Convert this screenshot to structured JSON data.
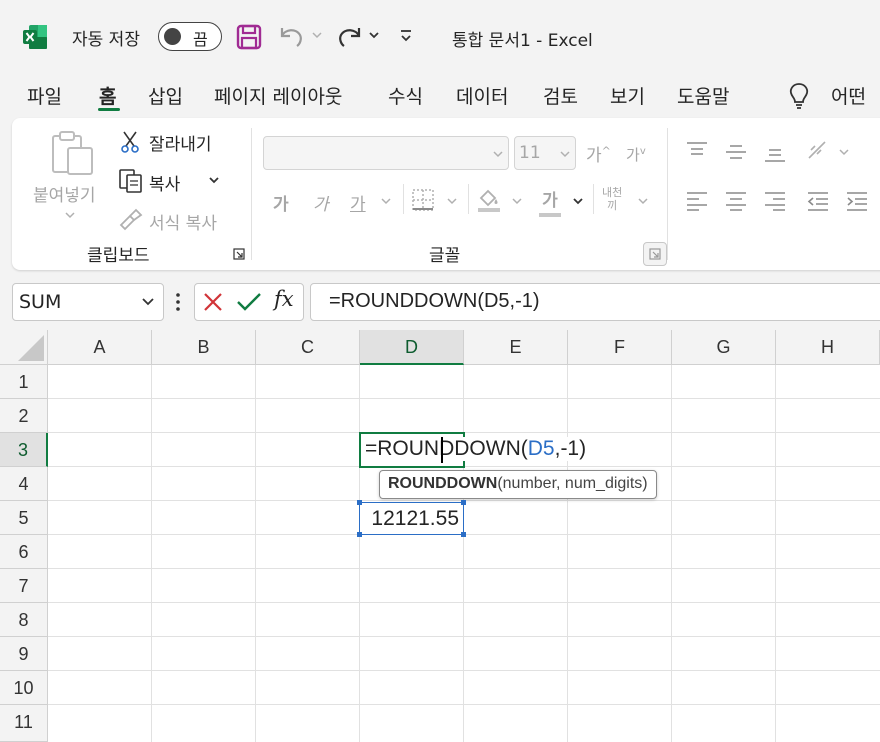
{
  "titlebar": {
    "autosave_label": "자동 저장",
    "autosave_state": "끔",
    "document_title": "통합 문서1  -  Excel"
  },
  "tabs": [
    {
      "label": "파일"
    },
    {
      "label": "홈",
      "active": true
    },
    {
      "label": "삽입"
    },
    {
      "label": "페이지 레이아웃"
    },
    {
      "label": "수식"
    },
    {
      "label": "데이터"
    },
    {
      "label": "검토"
    },
    {
      "label": "보기"
    },
    {
      "label": "도움말"
    }
  ],
  "tell_me": "어떤",
  "ribbon": {
    "clipboard": {
      "paste": "붙여넣기",
      "cut": "잘라내기",
      "copy": "복사",
      "format_painter": "서식 복사",
      "group_label": "클립보드"
    },
    "font": {
      "font_name": "",
      "font_size": "11",
      "grow": "가",
      "shrink": "가",
      "bold": "가",
      "italic": "가",
      "underline": "가",
      "font_color_glyph": "가",
      "phonetic_top": "내천",
      "phonetic_bottom": "끼",
      "group_label": "글꼴"
    }
  },
  "formula_bar": {
    "name_box": "SUM",
    "fx": "fx",
    "formula": "=ROUNDDOWN(D5,-1)"
  },
  "grid": {
    "columns": [
      "A",
      "B",
      "C",
      "D",
      "E",
      "F",
      "G",
      "H"
    ],
    "rows": [
      "1",
      "2",
      "3",
      "4",
      "5",
      "6",
      "7",
      "8",
      "9",
      "10",
      "11"
    ],
    "active_column": "D",
    "active_row": "3"
  },
  "edit_cell": {
    "prefix": "=ROUNDDOWN(",
    "ref": "D5",
    "suffix": ",-1)"
  },
  "tooltip": {
    "function": "ROUNDDOWN",
    "args": "(number, num_digits)"
  },
  "cells": {
    "D5": "12121.55"
  },
  "colors": {
    "accent": "#107c41",
    "reference": "#2b6ec6",
    "save": "#a02b93"
  }
}
